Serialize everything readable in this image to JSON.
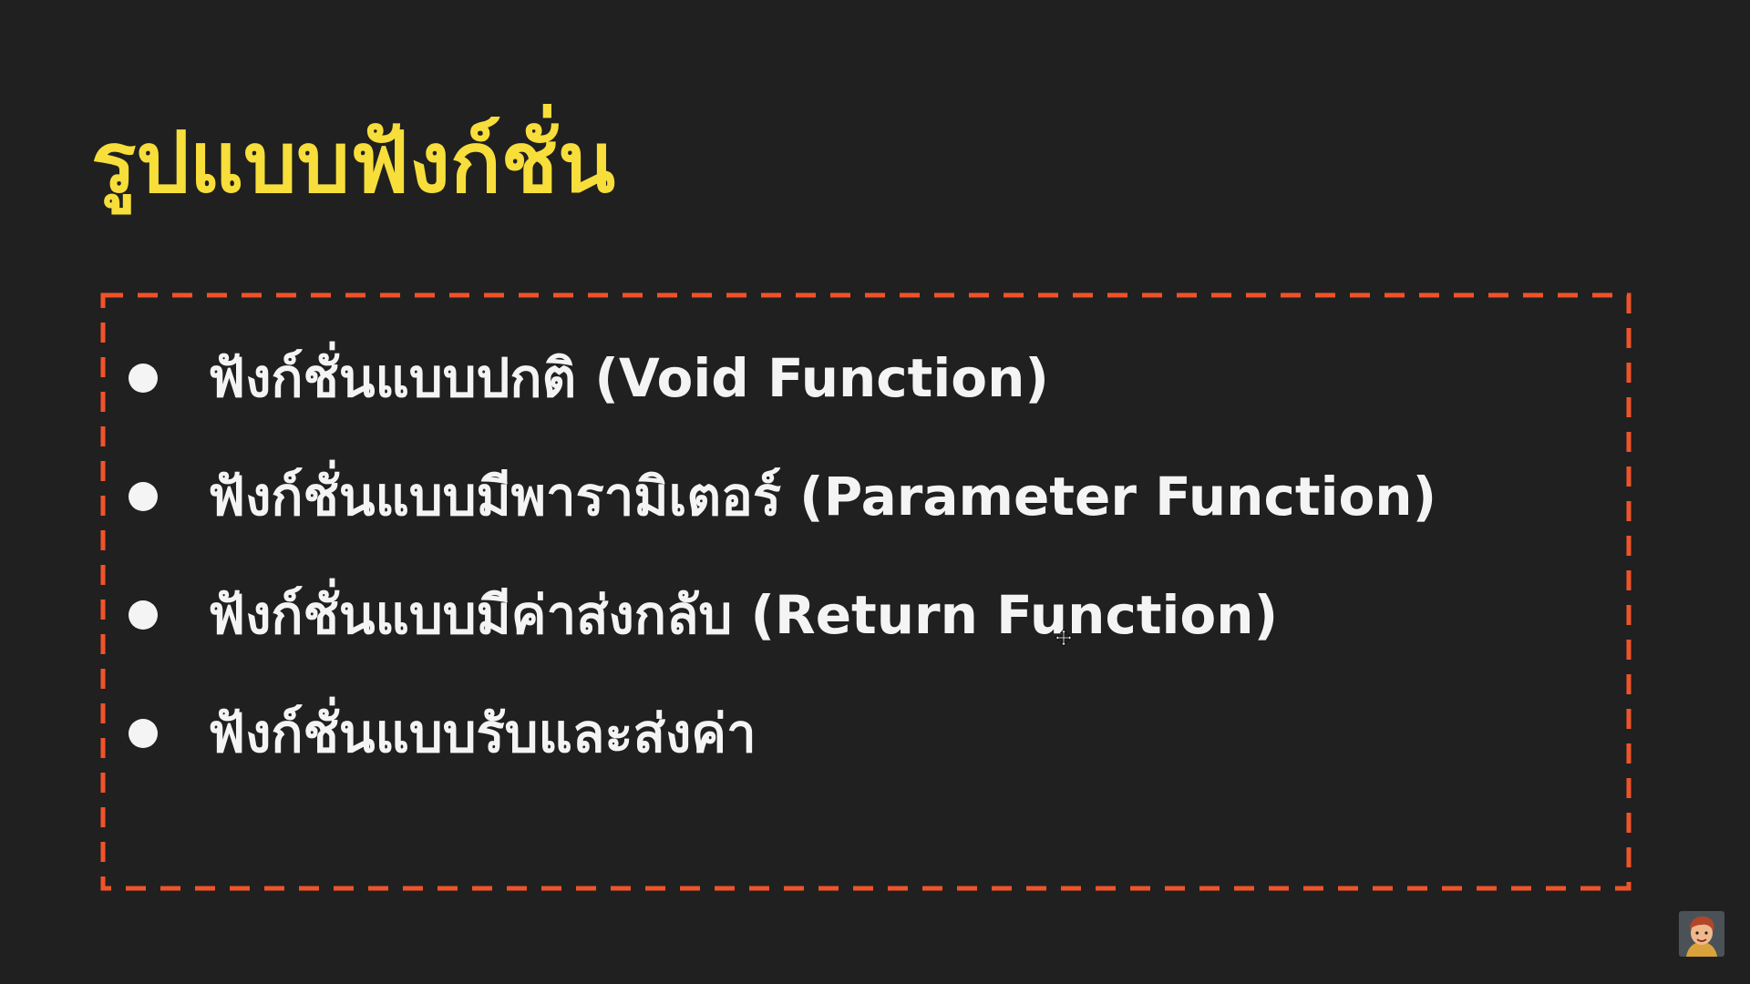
{
  "slide": {
    "title": "รูปแบบฟังก์ชั่น",
    "items": [
      {
        "label": "ฟังก์ชั่นแบบปกติ (Void Function)"
      },
      {
        "label": "ฟังก์ชั่นแบบมีพารามิเตอร์ (Parameter Function)"
      },
      {
        "label": "ฟังก์ชั่นแบบมีค่าส่งกลับ (Return Function)"
      },
      {
        "label": "ฟังก์ชั่นแบบรับและส่งค่า"
      }
    ]
  },
  "icons": {
    "bullet": "bullet-dot-icon",
    "cursor": "move-cursor-icon",
    "avatar": "presenter-avatar"
  },
  "colors": {
    "background": "#202020",
    "title": "#F7DE3A",
    "text": "#F4F4F4",
    "frame_border": "#F0532A"
  }
}
